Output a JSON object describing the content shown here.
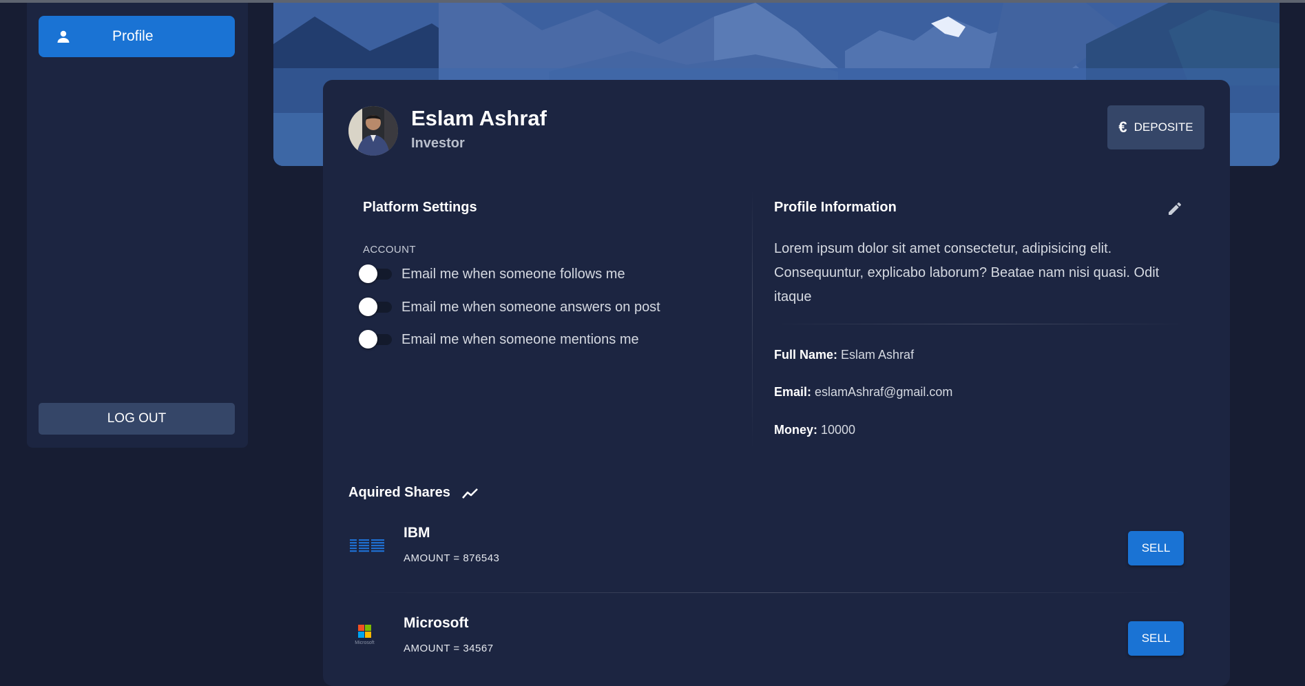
{
  "sidebar": {
    "nav_profile_label": "Profile",
    "logout_label": "LOG OUT"
  },
  "profile": {
    "name": "Eslam Ashraf",
    "role": "Investor",
    "deposit_label": "DEPOSITE",
    "deposit_icon": "euro-icon"
  },
  "settings": {
    "title": "Platform Settings",
    "section": "ACCOUNT",
    "toggles": [
      {
        "label": "Email me when someone follows me",
        "on": false
      },
      {
        "label": "Email me when someone answers on post",
        "on": false
      },
      {
        "label": "Email me when someone mentions me",
        "on": false
      }
    ]
  },
  "info": {
    "title": "Profile Information",
    "bio": "Lorem ipsum dolor sit amet consectetur, adipisicing elit. Consequuntur, explicabo laborum? Beatae nam nisi quasi. Odit itaque",
    "full_name_label": "Full Name:",
    "full_name": "Eslam Ashraf",
    "email_label": "Email:",
    "email": "eslamAshraf@gmail.com",
    "money_label": "Money:",
    "money": "10000"
  },
  "shares": {
    "title": "Aquired Shares",
    "items": [
      {
        "name": "IBM",
        "amount": "AMOUNT = 876543",
        "sell_label": "SELL",
        "logo": "ibm-logo"
      },
      {
        "name": "Microsoft",
        "amount": "AMOUNT = 34567",
        "sell_label": "SELL",
        "logo": "microsoft-logo",
        "logo_caption": "Microsoft"
      }
    ]
  },
  "colors": {
    "background": "#171d33",
    "card": "#1c2541",
    "accent": "#1a73d4",
    "secondary_button": "#354668"
  }
}
